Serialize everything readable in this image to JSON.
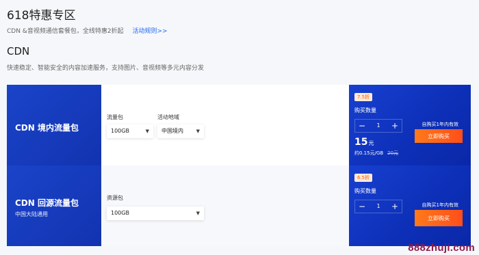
{
  "page": {
    "title": "618特惠专区",
    "subtitle": "CDN &音视频通信套餐包，全线特惠2折起",
    "rules_link": "活动规则>>"
  },
  "section": {
    "title": "CDN",
    "desc": "快速稳定、智能安全的内容加速服务，支持图片、音视频等多元内容分发"
  },
  "products": [
    {
      "name": "CDN 境内流量包",
      "fields": [
        {
          "label": "流量包",
          "value": "100GB"
        },
        {
          "label": "活动地域",
          "value": "中国境内"
        }
      ],
      "discount": "7.5折",
      "qty_label": "购买数量",
      "qty": "1",
      "price": "15",
      "price_unit": "元",
      "unit_price": "约0.15元/GB",
      "orig_price": "20元",
      "note": "自购买1年内有效",
      "buy_label": "立即购买"
    },
    {
      "name": "CDN 回源流量包",
      "sub": "中国大陆通用",
      "fields": [
        {
          "label": "资源包",
          "value": "100GB"
        }
      ],
      "discount": "6.5折",
      "qty_label": "购买数量",
      "qty": "1",
      "note": "自购买1年内有效",
      "buy_label": "立即购买"
    }
  ],
  "icons": {
    "minus": "minus-icon",
    "plus": "plus-icon",
    "arrow": "caret-down-icon"
  },
  "colors": {
    "accent": "#2468f2",
    "panel_blue": "#1233b0",
    "buy_orange": "#ff5a1a",
    "discount_text": "#ff5a00"
  },
  "watermark": "888zhuji.com"
}
